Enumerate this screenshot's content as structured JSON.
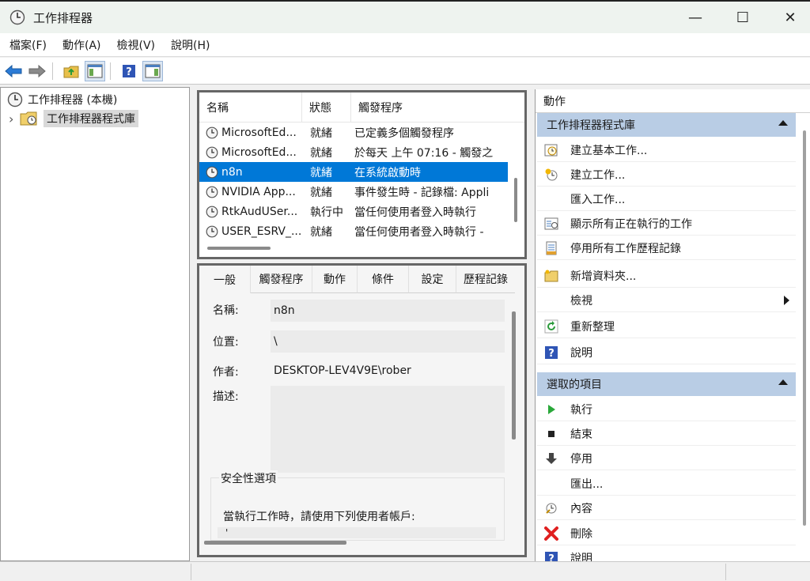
{
  "window": {
    "title": "工作排程器",
    "controls": {
      "minimize": "—",
      "maximize": "☐",
      "close": "✕"
    }
  },
  "menu": [
    "檔案(F)",
    "動作(A)",
    "檢視(V)",
    "說明(H)"
  ],
  "toolbar": {
    "icons": [
      "back-arrow-icon",
      "forward-arrow-icon",
      "up-folder-icon",
      "show-hide-console-tree-icon",
      "help-icon",
      "show-hide-action-pane-icon"
    ]
  },
  "tree": {
    "root": "工作排程器 (本機)",
    "library": "工作排程器程式庫",
    "expander": "›"
  },
  "task_list": {
    "columns": [
      "名稱",
      "狀態",
      "觸發程序"
    ],
    "rows": [
      {
        "name": "MicrosoftEd...",
        "status": "就緒",
        "trigger": "已定義多個觸發程序"
      },
      {
        "name": "MicrosoftEd...",
        "status": "就緒",
        "trigger": "於每天 上午 07:16 - 觸發之"
      },
      {
        "name": "n8n",
        "status": "就緒",
        "trigger": "在系統啟動時"
      },
      {
        "name": "NVIDIA App...",
        "status": "就緒",
        "trigger": "事件發生時 - 記錄檔: Appli"
      },
      {
        "name": "RtkAudUSer...",
        "status": "執行中",
        "trigger": "當任何使用者登入時執行"
      },
      {
        "name": "USER_ESRV_...",
        "status": "就緒",
        "trigger": "當任何使用者登入時執行 -"
      }
    ],
    "selected_index": 2
  },
  "details": {
    "tabs": [
      "一般",
      "觸發程序",
      "動作",
      "條件",
      "設定",
      "歷程記錄"
    ],
    "active_tab": "一般",
    "name_label": "名稱:",
    "name_value": "n8n",
    "location_label": "位置:",
    "location_value": "\\",
    "author_label": "作者:",
    "author_value": "DESKTOP-LEV4V9E\\rober",
    "desc_label": "描述:",
    "desc_value": "",
    "security_title": "安全性選項",
    "security_text": "當執行工作時，請使用下列使用者帳戶:",
    "security_value": "'"
  },
  "actions_pane": {
    "header": "動作",
    "section1": {
      "title": "工作排程器程式庫",
      "items": [
        {
          "label": "建立基本工作...",
          "icon": "create-basic-task-icon"
        },
        {
          "label": "建立工作...",
          "icon": "create-task-icon"
        },
        {
          "label": "匯入工作...",
          "icon": ""
        },
        {
          "label": "顯示所有正在執行的工作",
          "icon": "running-tasks-icon"
        },
        {
          "label": "停用所有工作歷程記錄",
          "icon": "history-log-icon"
        },
        {
          "label": "新增資料夾...",
          "icon": "new-folder-icon"
        },
        {
          "label": "檢視",
          "icon": ""
        },
        {
          "label": "重新整理",
          "icon": "refresh-icon"
        },
        {
          "label": "說明",
          "icon": "help-icon"
        }
      ]
    },
    "section2": {
      "title": "選取的項目",
      "items": [
        {
          "label": "執行",
          "icon": "run-icon"
        },
        {
          "label": "結束",
          "icon": "end-icon"
        },
        {
          "label": "停用",
          "icon": "disable-icon"
        },
        {
          "label": "匯出...",
          "icon": ""
        },
        {
          "label": "內容",
          "icon": "properties-icon"
        },
        {
          "label": "刪除",
          "icon": "delete-icon"
        },
        {
          "label": "說明",
          "icon": "help-icon"
        }
      ]
    }
  },
  "colors": {
    "selection": "#0078d7",
    "section_header": "#b9cde5",
    "title_bar": "#eef3ef"
  }
}
